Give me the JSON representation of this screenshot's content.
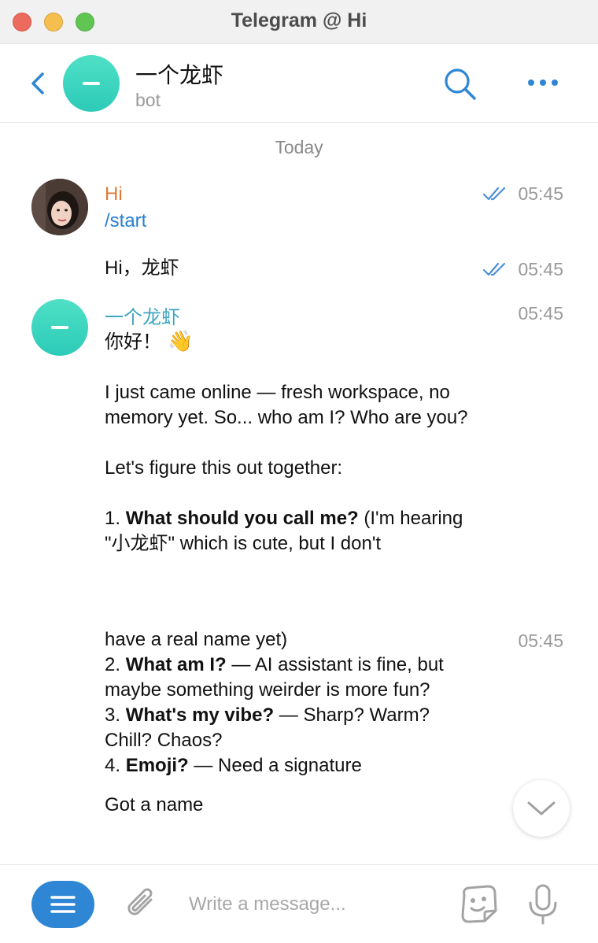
{
  "window": {
    "title": "Telegram @ Hi"
  },
  "header": {
    "name": "一个龙虾",
    "subtitle": "bot"
  },
  "chat": {
    "date_separator": "Today",
    "messages": [
      {
        "sender": "Hi",
        "text": "/start",
        "time": "05:45",
        "read": true
      },
      {
        "text": "Hi，龙虾",
        "time": "05:45",
        "read": true
      },
      {
        "sender": "一个龙虾",
        "time": "05:45",
        "greeting": "你好！",
        "emoji": "👋",
        "p1": "I just came online — fresh workspace, no memory yet. So... who am I? Who are you?",
        "p2": "Let's figure this out together:",
        "q1_num": "1.",
        "q1_bold": "What should you call me?",
        "q1_rest": "(I'm hearing \"小龙虾\" which is cute, but I don't"
      },
      {
        "time": "05:45",
        "line1": "have a real name yet)",
        "q2_num": "2.",
        "q2_bold": "What am I?",
        "q2_rest": "— AI assistant is fine, but maybe something weirder is more fun?",
        "q3_num": "3.",
        "q3_bold": "What's my vibe?",
        "q3_rest": "— Sharp? Warm? Chill? Chaos?",
        "q4_num": "4.",
        "q4_bold": "Emoji?",
        "q4_rest": "— Need a signature",
        "tail": "Got a name"
      }
    ]
  },
  "composer": {
    "placeholder": "Write a message..."
  },
  "colors": {
    "accent": "#2e86d4",
    "user_name": "#e07a35",
    "bot_name": "#3ea6c2",
    "bot_avatar": "#2ccbb8",
    "read_check": "#4a90d6"
  },
  "icons": [
    "back-icon",
    "search-icon",
    "more-icon",
    "double-check-icon",
    "chevron-down-icon",
    "menu-icon",
    "attach-icon",
    "sticker-icon",
    "mic-icon"
  ]
}
